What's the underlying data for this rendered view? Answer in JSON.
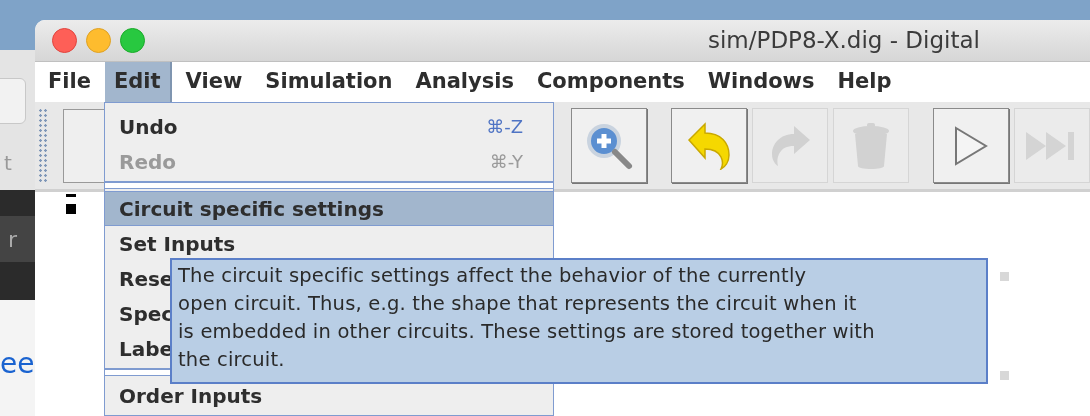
{
  "background_window": {
    "texts": [
      "t",
      "r",
      "ee"
    ]
  },
  "window": {
    "title": "sim/PDP8-X.dig - Digital"
  },
  "menubar": [
    {
      "label": "File",
      "selected": false
    },
    {
      "label": "Edit",
      "selected": true
    },
    {
      "label": "View",
      "selected": false
    },
    {
      "label": "Simulation",
      "selected": false
    },
    {
      "label": "Analysis",
      "selected": false
    },
    {
      "label": "Components",
      "selected": false
    },
    {
      "label": "Windows",
      "selected": false
    },
    {
      "label": "Help",
      "selected": false
    }
  ],
  "toolbar": [
    {
      "kind": "zoom",
      "disabled": false
    },
    {
      "kind": "undo",
      "disabled": false
    },
    {
      "kind": "redo",
      "disabled": true
    },
    {
      "kind": "delete",
      "disabled": true
    },
    {
      "kind": "play",
      "disabled": false
    },
    {
      "kind": "fast-forward",
      "disabled": true
    }
  ],
  "edit_menu": [
    {
      "kind": "item",
      "label": "Undo",
      "shortcut": "⌘-Z",
      "disabled": false,
      "selected": false
    },
    {
      "kind": "item",
      "label": "Redo",
      "shortcut": "⌘-Y",
      "disabled": true,
      "selected": false
    },
    {
      "kind": "separator"
    },
    {
      "kind": "item",
      "label": "Circuit specific settings",
      "disabled": false,
      "selected": true
    },
    {
      "kind": "item",
      "label": "Set Inputs",
      "disabled": false,
      "selected": false
    },
    {
      "kind": "item",
      "label": "Rese",
      "disabled": false,
      "selected": false
    },
    {
      "kind": "item",
      "label": "Spec",
      "disabled": false,
      "selected": false
    },
    {
      "kind": "item",
      "label": "Labe",
      "disabled": false,
      "selected": false
    },
    {
      "kind": "separator"
    },
    {
      "kind": "item",
      "label": "Order Inputs",
      "disabled": false,
      "selected": false
    }
  ],
  "tooltip": {
    "lines": [
      "The circuit specific settings affect the behavior of the currently",
      "open circuit. Thus, e.g. the shape that represents the circuit when it",
      "is embedded in other circuits. These settings are stored together with",
      "the circuit."
    ]
  }
}
